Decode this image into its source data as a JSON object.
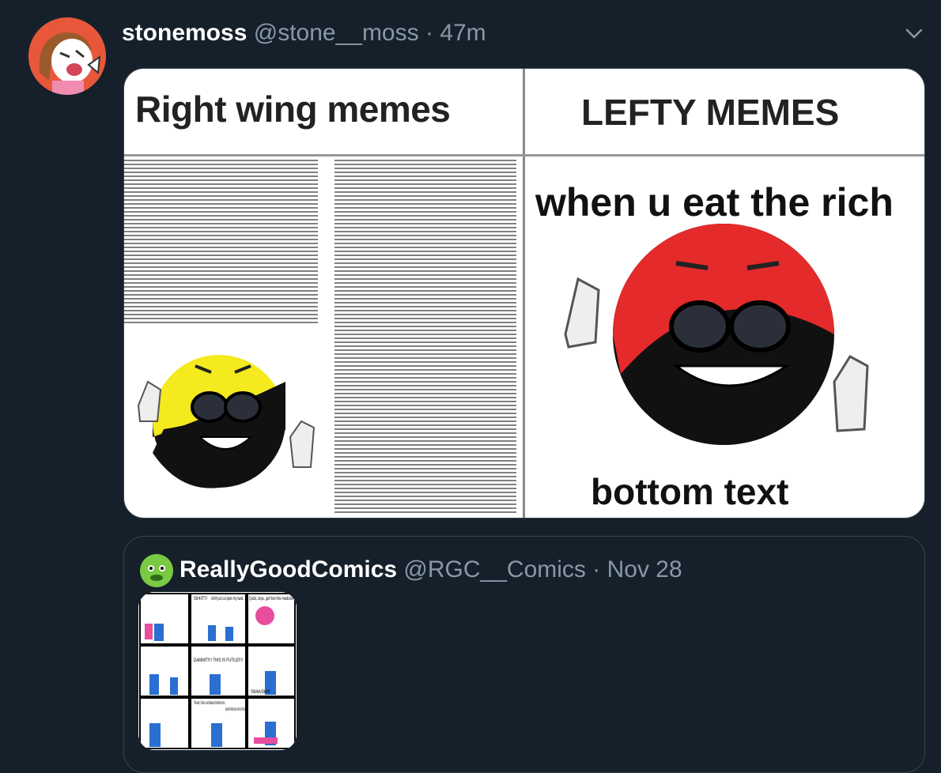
{
  "tweet": {
    "display_name": "stonemoss",
    "handle": "@stone__moss",
    "separator": "·",
    "time": "47m",
    "avatar_icon": "cartoon-avatar-icon",
    "menu_icon": "chevron-down-icon"
  },
  "meme": {
    "left_title": "Right wing memes",
    "right_title": "LEFTY MEMES",
    "right_caption": "when u eat the rich",
    "bottom_text": "bottom text"
  },
  "quoted_tweet": {
    "display_name": "ReallyGoodComics",
    "handle": "@RGC__Comics",
    "separator": "·",
    "date": "Nov 28",
    "comic_text": [
      "SHIT!!",
      "Ahhh just cut open my hand..",
      "Quick, boys, get from the medicine",
      "DAMMIT!!!! THIS IS FUTILE!!!!",
      "SMASH!!",
      "Think about it, if there's a secret hideaway in the bathroom mirror..",
      "Imagine all the hidden treasures in the rest of the house!!"
    ]
  },
  "colors": {
    "background": "#15202b",
    "muted": "#8899a6",
    "border": "#38444d"
  }
}
